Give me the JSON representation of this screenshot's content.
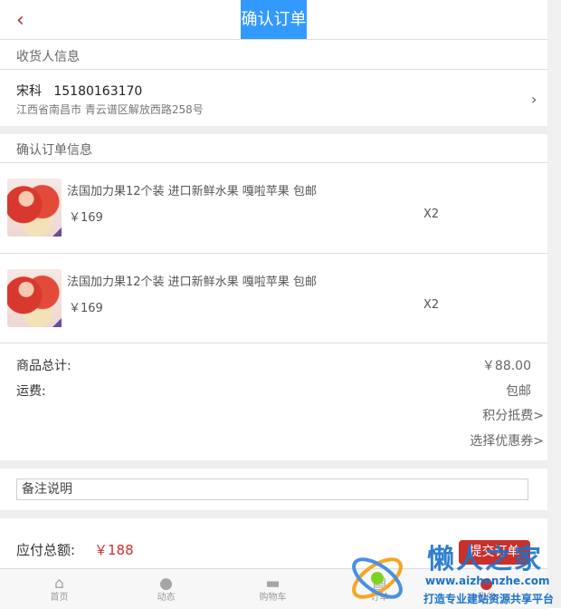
{
  "header": {
    "title": "确认订单",
    "back_icon": "chevron-left-icon"
  },
  "receiver": {
    "section_title": "收货人信息",
    "name": "宋科",
    "phone": "15180163170",
    "address": "江西省南昌市 青云谱区解放西路258号"
  },
  "order_info": {
    "section_title": "确认订单信息",
    "items": [
      {
        "name": "法国加力果12个装 进口新鲜水果 嘎啦苹果 包邮",
        "price": "￥169",
        "qty": "X2"
      },
      {
        "name": "法国加力果12个装 进口新鲜水果 嘎啦苹果 包邮",
        "price": "￥169",
        "qty": "X2"
      }
    ]
  },
  "summary": {
    "subtotal_label": "商品总计:",
    "subtotal_value": "￥88.00",
    "shipping_label": "运费:",
    "shipping_value": "包邮",
    "points_link": "积分抵费>",
    "coupon_link": "选择优惠券>"
  },
  "remark": {
    "value": "备注说明"
  },
  "footer": {
    "total_label": "应付总额:",
    "total_value": "￥188",
    "submit_label": "提交订单"
  },
  "tabbar": [
    {
      "label": "首页",
      "icon": "home-icon",
      "glyph": "⌂"
    },
    {
      "label": "动态",
      "icon": "chat-icon",
      "glyph": "●"
    },
    {
      "label": "购物车",
      "icon": "cart-icon",
      "glyph": "▬"
    },
    {
      "label": "订单",
      "icon": "order-icon",
      "glyph": "▤"
    },
    {
      "label": "我的",
      "icon": "user-icon",
      "glyph": "●"
    }
  ],
  "watermark": {
    "brand": "懒人之家",
    "url": "www.aizhenzhe.com",
    "slogan": "打造专业建站资源共享平台"
  },
  "colors": {
    "accent": "#c9302c",
    "title_bg": "#3399ff",
    "divider": "#eeeeee"
  }
}
